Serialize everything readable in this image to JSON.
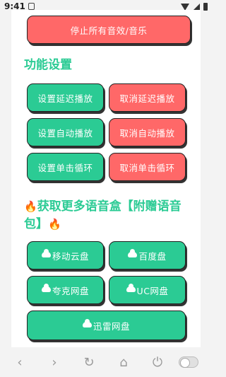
{
  "status_bar": {
    "time": "9:41"
  },
  "top_button": {
    "label": "停止所有音效/音乐"
  },
  "section_settings": {
    "title": "功能设置"
  },
  "settings_buttons": {
    "set_delay": "设置延迟播放",
    "cancel_delay": "取消延迟播放",
    "set_auto": "设置自动播放",
    "cancel_auto": "取消自动播放",
    "set_loop": "设置单击循环",
    "cancel_loop": "取消单击循环"
  },
  "section_more": {
    "title_line1": "获取更多语音盒【附赠语音",
    "title_line2": "包】"
  },
  "cloud_buttons": {
    "mobile": "移动云盘",
    "baidu": "百度盘",
    "quark": "夸克网盘",
    "uc": "UC网盘",
    "xunlei": "迅雷网盘"
  },
  "nav": {
    "back": "‹",
    "forward": "›",
    "refresh": "↻",
    "home": "⌂",
    "power": "⏻"
  },
  "colors": {
    "red": "#ff6868",
    "green": "#2bcb94",
    "title_green": "#2bcb94"
  }
}
